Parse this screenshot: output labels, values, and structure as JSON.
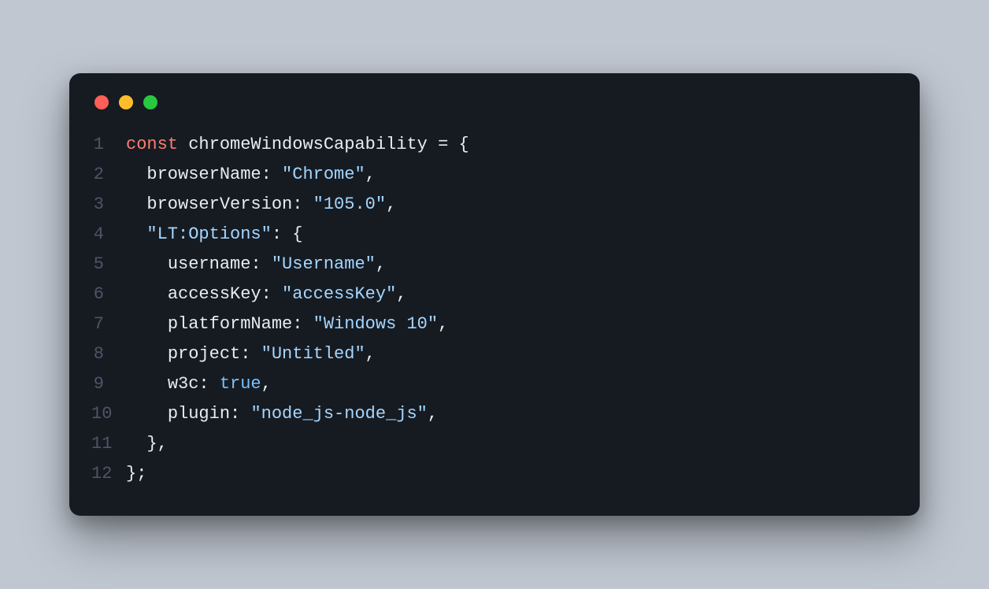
{
  "colors": {
    "background": "#c0c7d1",
    "editor_bg": "#161b22",
    "traffic_red": "#ff5f56",
    "traffic_yellow": "#ffbd2e",
    "traffic_green": "#27c93f",
    "line_number": "#4d5566",
    "keyword": "#ff7b72",
    "text": "#e6edf3",
    "string": "#a5d6ff",
    "bool": "#79c0ff"
  },
  "line_numbers": [
    "1",
    "2",
    "3",
    "4",
    "5",
    "6",
    "7",
    "8",
    "9",
    "10",
    "11",
    "12"
  ],
  "tokens": {
    "l1_keyword": "const",
    "l1_sp1": " ",
    "l1_var": "chromeWindowsCapability",
    "l1_rest": " = {",
    "l2_indent": "  ",
    "l2_prop": "browserName",
    "l2_colon": ": ",
    "l2_str": "\"Chrome\"",
    "l2_end": ",",
    "l3_indent": "  ",
    "l3_prop": "browserVersion",
    "l3_colon": ": ",
    "l3_str": "\"105.0\"",
    "l3_end": ",",
    "l4_indent": "  ",
    "l4_str": "\"LT:Options\"",
    "l4_rest": ": {",
    "l5_indent": "    ",
    "l5_prop": "username",
    "l5_colon": ": ",
    "l5_str": "\"Username\"",
    "l5_end": ",",
    "l6_indent": "    ",
    "l6_prop": "accessKey",
    "l6_colon": ": ",
    "l6_str": "\"accessKey\"",
    "l6_end": ",",
    "l7_indent": "    ",
    "l7_prop": "platformName",
    "l7_colon": ": ",
    "l7_str": "\"Windows 10\"",
    "l7_end": ",",
    "l8_indent": "    ",
    "l8_prop": "project",
    "l8_colon": ": ",
    "l8_str": "\"Untitled\"",
    "l8_end": ",",
    "l9_indent": "    ",
    "l9_prop": "w3c",
    "l9_colon": ": ",
    "l9_bool": "true",
    "l9_end": ",",
    "l10_indent": "    ",
    "l10_prop": "plugin",
    "l10_colon": ": ",
    "l10_str": "\"node_js-node_js\"",
    "l10_end": ",",
    "l11_text": "  },",
    "l12_text": "};"
  }
}
